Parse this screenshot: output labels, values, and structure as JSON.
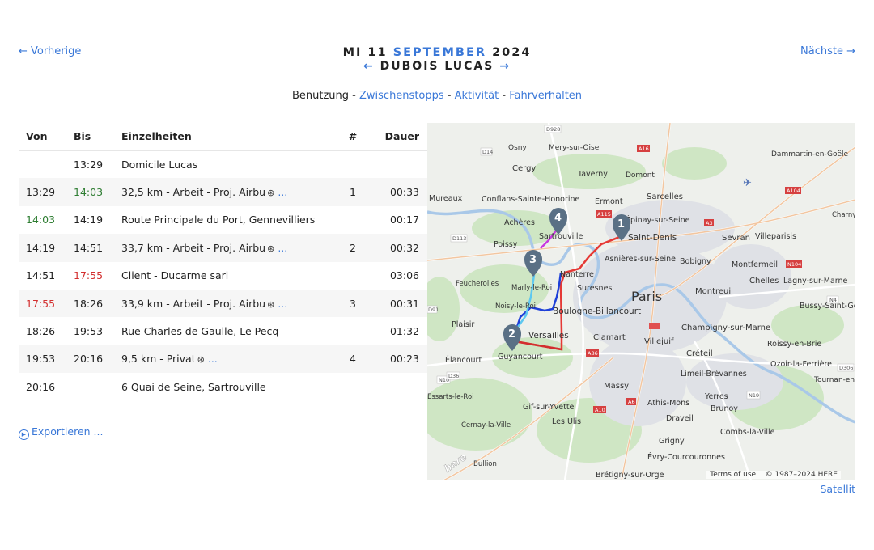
{
  "nav": {
    "prev_label": "← Vorherige",
    "next_label": "Nächste →"
  },
  "header": {
    "weekday_day": "MI 11",
    "month": "SEPTEMBER",
    "year": "2024",
    "person": "DUBOIS LUCAS",
    "arrow_left": "←",
    "arrow_right": "→"
  },
  "subnav": {
    "current": "Benutzung",
    "separator": "-",
    "links": [
      "Zwischenstopps",
      "Aktivität",
      "Fahrverhalten"
    ]
  },
  "table": {
    "headers": {
      "from": "Von",
      "to": "Bis",
      "details": "Einzelheiten",
      "num": "#",
      "duration": "Dauer"
    },
    "more_label": "...",
    "rows": [
      {
        "from": "",
        "to": "13:29",
        "details": "Domicile Lucas",
        "num": "",
        "duration": ""
      },
      {
        "from": "13:29",
        "to": "14:03",
        "details": "32,5 km - Arbeit - Proj. Airbu",
        "num": "1",
        "duration": "00:33"
      },
      {
        "from": "14:03",
        "to": "14:19",
        "details": "Route Principale du Port, Gennevilliers",
        "num": "",
        "duration": "00:17"
      },
      {
        "from": "14:19",
        "to": "14:51",
        "details": "33,7 km - Arbeit - Proj. Airbu",
        "num": "2",
        "duration": "00:32"
      },
      {
        "from": "14:51",
        "to": "17:55",
        "details": "Client - Ducarme sarl",
        "num": "",
        "duration": "03:06"
      },
      {
        "from": "17:55",
        "to": "18:26",
        "details": "33,9 km - Arbeit - Proj. Airbu",
        "num": "3",
        "duration": "00:31"
      },
      {
        "from": "18:26",
        "to": "19:53",
        "details": "Rue Charles de Gaulle, Le Pecq",
        "num": "",
        "duration": "01:32"
      },
      {
        "from": "19:53",
        "to": "20:16",
        "details": "9,5 km - Privat",
        "num": "4",
        "duration": "00:23"
      },
      {
        "from": "20:16",
        "to": "",
        "details": "6 Quai de Seine, Sartrouville",
        "num": "",
        "duration": ""
      }
    ]
  },
  "export_label": "Exportieren ...",
  "map": {
    "places": {
      "paris": "Paris",
      "cergy": "Cergy",
      "osny": "Osny",
      "mery": "Mery-sur-Oise",
      "taverny": "Taverny",
      "domont": "Domont",
      "dammartin": "Dammartin-en-Goële",
      "mureaux": "Mureaux",
      "conflans": "Conflans-Sainte-Honorine",
      "ermont": "Ermont",
      "sarcelles": "Sarcelles",
      "acheres": "Achères",
      "epinay": "Épinay-sur-Seine",
      "saint_denis": "Saint-Denis",
      "sevran": "Sevran",
      "villeparisis": "Villeparisis",
      "charny": "Charny",
      "poissy": "Poissy",
      "sartrouville": "Sartrouville",
      "asnieres": "Asnières-sur-Seine",
      "bobigny": "Bobigny",
      "montfermeil": "Montfermeil",
      "feucherolles": "Feucherolles",
      "nanterre": "Nanterre",
      "chelles": "Chelles",
      "lagny": "Lagny-sur-Marne",
      "marly": "Marly-le-Roi",
      "suresnes": "Suresnes",
      "montreuil": "Montreuil",
      "noisy": "Noisy-le-Roi",
      "boulogne": "Boulogne-Billancourt",
      "bussy": "Bussy-Saint-Georges",
      "plaisir": "Plaisir",
      "champigny": "Champigny-sur-Marne",
      "versailles": "Versailles",
      "clamart": "Clamart",
      "villejuif": "Villejuif",
      "roissy": "Roissy-en-Brie",
      "elancourt": "Élancourt",
      "guyancourt": "Guyancourt",
      "creteil": "Créteil",
      "ozoir": "Ozoir-la-Ferrière",
      "limeil": "Limeil-Brévannes",
      "tournan": "Tournan-en-Brie",
      "massy": "Massy",
      "essarts": "Essarts-le-Roi",
      "athis": "Athis-Mons",
      "yerres": "Yerres",
      "gif": "Gif-sur-Yvette",
      "brunoy": "Brunoy",
      "ulis": "Les Ulis",
      "draveil": "Draveil",
      "cernay": "Cernay-la-Ville",
      "combs": "Combs-la-Ville",
      "grigny": "Grigny",
      "evry": "Évry-Courcouronnes",
      "bullion": "Bullion",
      "bretigny": "Brétigny-sur-Orge"
    },
    "roads": [
      "D928",
      "D14",
      "A16",
      "A115",
      "D113",
      "A3",
      "A86",
      "A6",
      "A10",
      "N10",
      "D91",
      "A104",
      "N104",
      "N4",
      "N19",
      "D306",
      "D36"
    ],
    "markers": [
      "1",
      "2",
      "3",
      "4"
    ],
    "logo": "here",
    "terms": "Terms of use",
    "copyright": "© 1987–2024 HERE",
    "route_colors": {
      "trip1": "#e53935",
      "trip2": "#d32f2f",
      "trip3": "#1e40d8",
      "trip3b": "#5ec8f0",
      "trip4": "#c83adf"
    },
    "marker_color": "#5a7085"
  },
  "satellit_label": "Satellit"
}
